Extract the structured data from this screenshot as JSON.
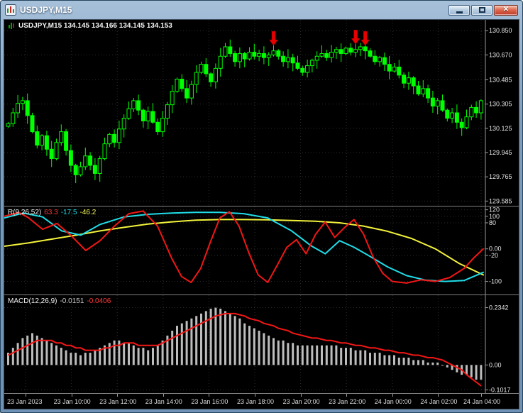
{
  "window": {
    "title": "USDJPY,M15",
    "close_glyph": "✕"
  },
  "main_chart": {
    "header": "USDJPY,M15  134.145 134.166 134.145 134.153"
  },
  "oscillator": {
    "label": "R(9,26,52)",
    "value1": "63.3",
    "value2": "-17.5",
    "value3": "-46.2"
  },
  "macd": {
    "label": "MACD(12,26,9)",
    "value1": "-0.0151",
    "value2": "-0.0406"
  },
  "chart_data": {
    "main": {
      "type": "candlestick",
      "y_range": [
        129.55,
        130.93
      ],
      "price_axis": [
        "130.850",
        "130.670",
        "130.485",
        "130.305",
        "130.125",
        "129.945",
        "129.765",
        "129.585"
      ],
      "price_axis_values": [
        130.85,
        130.67,
        130.485,
        130.305,
        130.125,
        129.945,
        129.765,
        129.585
      ],
      "candle_color": "#00ff00",
      "arrow_color": "#e60000",
      "sell_arrow_indices": [
        55,
        72,
        74
      ],
      "closes": [
        130.16,
        130.24,
        130.31,
        130.33,
        130.22,
        130.1,
        130.0,
        130.07,
        129.97,
        129.9,
        130.02,
        130.1,
        129.96,
        129.85,
        129.78,
        129.84,
        129.92,
        129.85,
        129.79,
        129.9,
        130.01,
        130.08,
        130.02,
        130.12,
        130.2,
        130.27,
        130.33,
        130.26,
        130.18,
        130.25,
        130.17,
        130.1,
        130.2,
        130.3,
        130.4,
        130.49,
        130.42,
        130.35,
        130.45,
        130.54,
        130.6,
        130.53,
        130.47,
        130.57,
        130.66,
        130.73,
        130.68,
        130.62,
        130.68,
        130.64,
        130.69,
        130.66,
        130.68,
        130.65,
        130.67,
        130.7,
        130.66,
        130.62,
        130.65,
        130.61,
        130.57,
        130.54,
        130.59,
        130.63,
        130.66,
        130.68,
        130.65,
        130.69,
        130.71,
        130.68,
        130.72,
        130.69,
        130.71,
        130.73,
        130.7,
        130.66,
        130.62,
        130.65,
        130.6,
        130.55,
        130.58,
        130.52,
        130.46,
        130.5,
        130.44,
        130.38,
        130.42,
        130.35,
        130.29,
        130.33,
        130.26,
        130.2,
        130.24,
        130.17,
        130.13,
        130.21,
        130.28,
        130.24,
        130.33
      ]
    },
    "oscillator": {
      "type": "line",
      "y_range": [
        -140,
        130
      ],
      "axis_labels": [
        "120",
        "100",
        "80",
        "0.00",
        "-20",
        "-100"
      ],
      "axis_values": [
        120,
        100,
        80,
        0,
        -20,
        -100
      ],
      "series": [
        {
          "name": "slow-line",
          "color": "#f2f23c",
          "width": 2,
          "points": [
            [
              0,
              8
            ],
            [
              5,
              18
            ],
            [
              10,
              30
            ],
            [
              15,
              42
            ],
            [
              20,
              55
            ],
            [
              25,
              66
            ],
            [
              30,
              76
            ],
            [
              35,
              83
            ],
            [
              40,
              88
            ],
            [
              45,
              90
            ],
            [
              50,
              90
            ],
            [
              55,
              89
            ],
            [
              60,
              87
            ],
            [
              65,
              85
            ],
            [
              70,
              80
            ],
            [
              75,
              70
            ],
            [
              80,
              54
            ],
            [
              85,
              32
            ],
            [
              90,
              0
            ],
            [
              95,
              -45
            ],
            [
              100,
              -80
            ]
          ]
        },
        {
          "name": "mid-line",
          "color": "#1fdde8",
          "width": 2,
          "points": [
            [
              0,
              95
            ],
            [
              4,
              110
            ],
            [
              8,
              98
            ],
            [
              12,
              55
            ],
            [
              16,
              42
            ],
            [
              20,
              75
            ],
            [
              25,
              98
            ],
            [
              30,
              106
            ],
            [
              35,
              110
            ],
            [
              40,
              112
            ],
            [
              45,
              112
            ],
            [
              50,
              108
            ],
            [
              55,
              95
            ],
            [
              60,
              55
            ],
            [
              64,
              10
            ],
            [
              67,
              -15
            ],
            [
              70,
              25
            ],
            [
              73,
              5
            ],
            [
              76,
              -20
            ],
            [
              80,
              -55
            ],
            [
              84,
              -82
            ],
            [
              88,
              -96
            ],
            [
              92,
              -100
            ],
            [
              96,
              -97
            ],
            [
              100,
              -72
            ]
          ]
        },
        {
          "name": "fast-line",
          "color": "#f21616",
          "width": 2,
          "points": [
            [
              0,
              100
            ],
            [
              3,
              112
            ],
            [
              5,
              96
            ],
            [
              8,
              60
            ],
            [
              11,
              78
            ],
            [
              14,
              40
            ],
            [
              17,
              -5
            ],
            [
              20,
              25
            ],
            [
              23,
              70
            ],
            [
              26,
              108
            ],
            [
              29,
              116
            ],
            [
              32,
              70
            ],
            [
              35,
              -30
            ],
            [
              37,
              -85
            ],
            [
              39,
              -103
            ],
            [
              41,
              -60
            ],
            [
              43,
              20
            ],
            [
              45,
              95
            ],
            [
              47,
              114
            ],
            [
              49,
              70
            ],
            [
              51,
              -10
            ],
            [
              53,
              -80
            ],
            [
              55,
              -103
            ],
            [
              57,
              -50
            ],
            [
              59,
              5
            ],
            [
              61,
              28
            ],
            [
              63,
              -15
            ],
            [
              65,
              45
            ],
            [
              67,
              82
            ],
            [
              69,
              35
            ],
            [
              71,
              65
            ],
            [
              73,
              90
            ],
            [
              75,
              45
            ],
            [
              77,
              -25
            ],
            [
              79,
              -75
            ],
            [
              81,
              -100
            ],
            [
              84,
              -105
            ],
            [
              87,
              -95
            ],
            [
              90,
              -100
            ],
            [
              93,
              -88
            ],
            [
              96,
              -60
            ],
            [
              98,
              -28
            ],
            [
              100,
              0
            ]
          ]
        }
      ]
    },
    "macd": {
      "type": "histogram+line",
      "y_range": [
        -0.115,
        0.285
      ],
      "axis_labels": [
        "0.2342",
        "0.00",
        "-0.1017"
      ],
      "axis_values": [
        0.2342,
        0,
        -0.1017
      ],
      "histogram_color": "#bdbdbd",
      "signal_color": "#f21616",
      "histogram": [
        0.05,
        0.07,
        0.09,
        0.11,
        0.12,
        0.13,
        0.12,
        0.11,
        0.1,
        0.09,
        0.08,
        0.07,
        0.06,
        0.05,
        0.05,
        0.04,
        0.05,
        0.05,
        0.06,
        0.07,
        0.08,
        0.09,
        0.1,
        0.1,
        0.09,
        0.09,
        0.08,
        0.07,
        0.07,
        0.06,
        0.07,
        0.08,
        0.1,
        0.12,
        0.14,
        0.16,
        0.17,
        0.18,
        0.19,
        0.2,
        0.21,
        0.22,
        0.23,
        0.234,
        0.23,
        0.22,
        0.21,
        0.2,
        0.19,
        0.17,
        0.16,
        0.15,
        0.14,
        0.13,
        0.12,
        0.11,
        0.1,
        0.1,
        0.09,
        0.09,
        0.08,
        0.08,
        0.08,
        0.08,
        0.08,
        0.08,
        0.08,
        0.08,
        0.08,
        0.07,
        0.07,
        0.07,
        0.06,
        0.06,
        0.06,
        0.05,
        0.05,
        0.05,
        0.04,
        0.04,
        0.04,
        0.03,
        0.03,
        0.03,
        0.02,
        0.02,
        0.02,
        0.01,
        0.01,
        0.01,
        0.0,
        -0.01,
        -0.02,
        -0.03,
        -0.04,
        -0.04,
        -0.05,
        -0.06,
        -0.06
      ],
      "signal": [
        0.04,
        0.05,
        0.06,
        0.07,
        0.08,
        0.09,
        0.1,
        0.1,
        0.1,
        0.1,
        0.09,
        0.09,
        0.08,
        0.08,
        0.07,
        0.07,
        0.06,
        0.06,
        0.06,
        0.06,
        0.07,
        0.07,
        0.08,
        0.08,
        0.09,
        0.09,
        0.09,
        0.08,
        0.08,
        0.08,
        0.08,
        0.08,
        0.09,
        0.1,
        0.11,
        0.12,
        0.13,
        0.14,
        0.15,
        0.16,
        0.17,
        0.18,
        0.19,
        0.2,
        0.205,
        0.21,
        0.21,
        0.21,
        0.205,
        0.2,
        0.19,
        0.185,
        0.18,
        0.17,
        0.165,
        0.16,
        0.15,
        0.145,
        0.14,
        0.13,
        0.125,
        0.12,
        0.115,
        0.11,
        0.11,
        0.105,
        0.1,
        0.1,
        0.095,
        0.09,
        0.09,
        0.085,
        0.08,
        0.08,
        0.075,
        0.07,
        0.07,
        0.065,
        0.06,
        0.06,
        0.055,
        0.05,
        0.05,
        0.045,
        0.04,
        0.04,
        0.035,
        0.03,
        0.03,
        0.025,
        0.02,
        0.01,
        0.0,
        -0.01,
        -0.02,
        -0.04,
        -0.055,
        -0.07,
        -0.085
      ]
    },
    "time_axis": [
      "23 Jan 2023",
      "23 Jan 10:00",
      "23 Jan 12:00",
      "23 Jan 14:00",
      "23 Jan 16:00",
      "23 Jan 18:00",
      "23 Jan 20:00",
      "23 Jan 22:00",
      "24 Jan 00:00",
      "24 Jan 02:00",
      "24 Jan 04:00"
    ]
  }
}
